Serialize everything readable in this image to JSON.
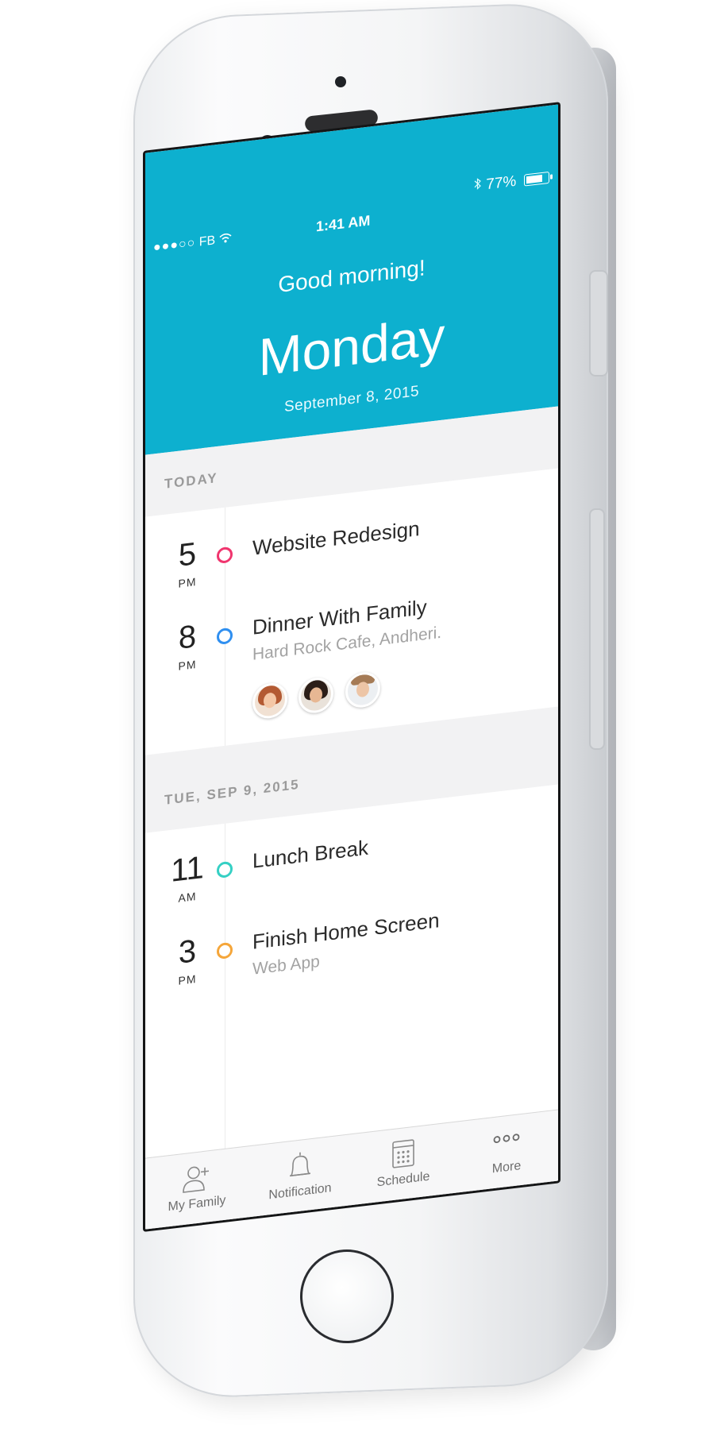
{
  "status_bar": {
    "signal": "●●●○○",
    "carrier": "FB",
    "time": "1:41 AM",
    "battery": "77%"
  },
  "header": {
    "greeting": "Good morning!",
    "day": "Monday",
    "date": "September 8, 2015",
    "background_color": "#0db0cf"
  },
  "sections": [
    {
      "heading": "TODAY",
      "events": [
        {
          "hour": "5",
          "ampm": "PM",
          "title": "Website Redesign",
          "ring_color": "#f0356e"
        },
        {
          "hour": "8",
          "ampm": "PM",
          "title": "Dinner With Family",
          "subtitle": "Hard Rock Cafe, Andheri.",
          "ring_color": "#2f8ff0",
          "attendees": 3
        }
      ]
    },
    {
      "heading": "TUE, SEP 9, 2015",
      "events": [
        {
          "hour": "11",
          "ampm": "AM",
          "title": "Lunch Break",
          "ring_color": "#35d0c4"
        },
        {
          "hour": "3",
          "ampm": "PM",
          "title": "Finish Home Screen",
          "subtitle": "Web App",
          "ring_color": "#f5a63a"
        }
      ]
    }
  ],
  "tab_bar": [
    {
      "label": "My Family",
      "icon": "add-user-icon"
    },
    {
      "label": "Notification",
      "icon": "bell-icon"
    },
    {
      "label": "Schedule",
      "icon": "calendar-grid-icon"
    },
    {
      "label": "More",
      "icon": "more-dots-icon"
    }
  ]
}
